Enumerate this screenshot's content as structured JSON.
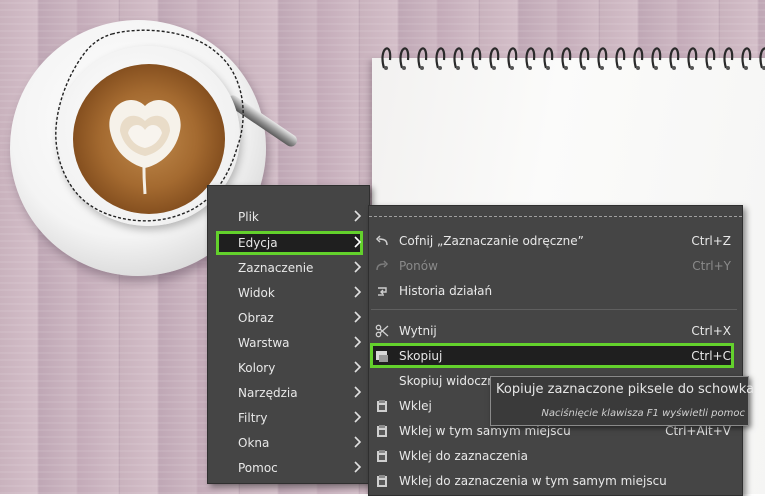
{
  "main_menu": {
    "items": [
      {
        "label": "Plik"
      },
      {
        "label": "Edycja",
        "selected": true
      },
      {
        "label": "Zaznaczenie"
      },
      {
        "label": "Widok"
      },
      {
        "label": "Obraz"
      },
      {
        "label": "Warstwa"
      },
      {
        "label": "Kolory"
      },
      {
        "label": "Narzędzia"
      },
      {
        "label": "Filtry"
      },
      {
        "label": "Okna"
      },
      {
        "label": "Pomoc"
      }
    ]
  },
  "edit_menu": {
    "items": [
      {
        "label": "Cofnij „Zaznaczanie odręczne”",
        "accel": "Ctrl+Z",
        "icon": "undo-icon"
      },
      {
        "label": "Ponów",
        "accel": "Ctrl+Y",
        "icon": "redo-icon",
        "disabled": true
      },
      {
        "label": "Historia działań",
        "accel": "",
        "icon": "history-icon"
      },
      {
        "label": "Wytnij",
        "accel": "Ctrl+X",
        "icon": "cut-icon"
      },
      {
        "label": "Skopiuj",
        "accel": "Ctrl+C",
        "icon": "copy-icon",
        "selected": true
      },
      {
        "label": "Skopiuj widoczne",
        "accel": "",
        "icon": ""
      },
      {
        "label": "Wklej",
        "accel": "",
        "icon": "paste-icon"
      },
      {
        "label": "Wklej w tym samym miejscu",
        "accel": "Ctrl+Alt+V",
        "icon": "paste-icon"
      },
      {
        "label": "Wklej do zaznaczenia",
        "accel": "",
        "icon": "paste-icon"
      },
      {
        "label": "Wklej do zaznaczenia w tym samym miejscu",
        "accel": "",
        "icon": "paste-icon"
      }
    ]
  },
  "tooltip": {
    "text": "Kopiuje zaznaczone piksele do schowka",
    "hint": "Naciśnięcie klawisza F1 wyświetli pomoc"
  },
  "colors": {
    "highlight_border": "#63d12c",
    "menu_background": "#454545",
    "highlight_background": "#1f1f1f"
  }
}
